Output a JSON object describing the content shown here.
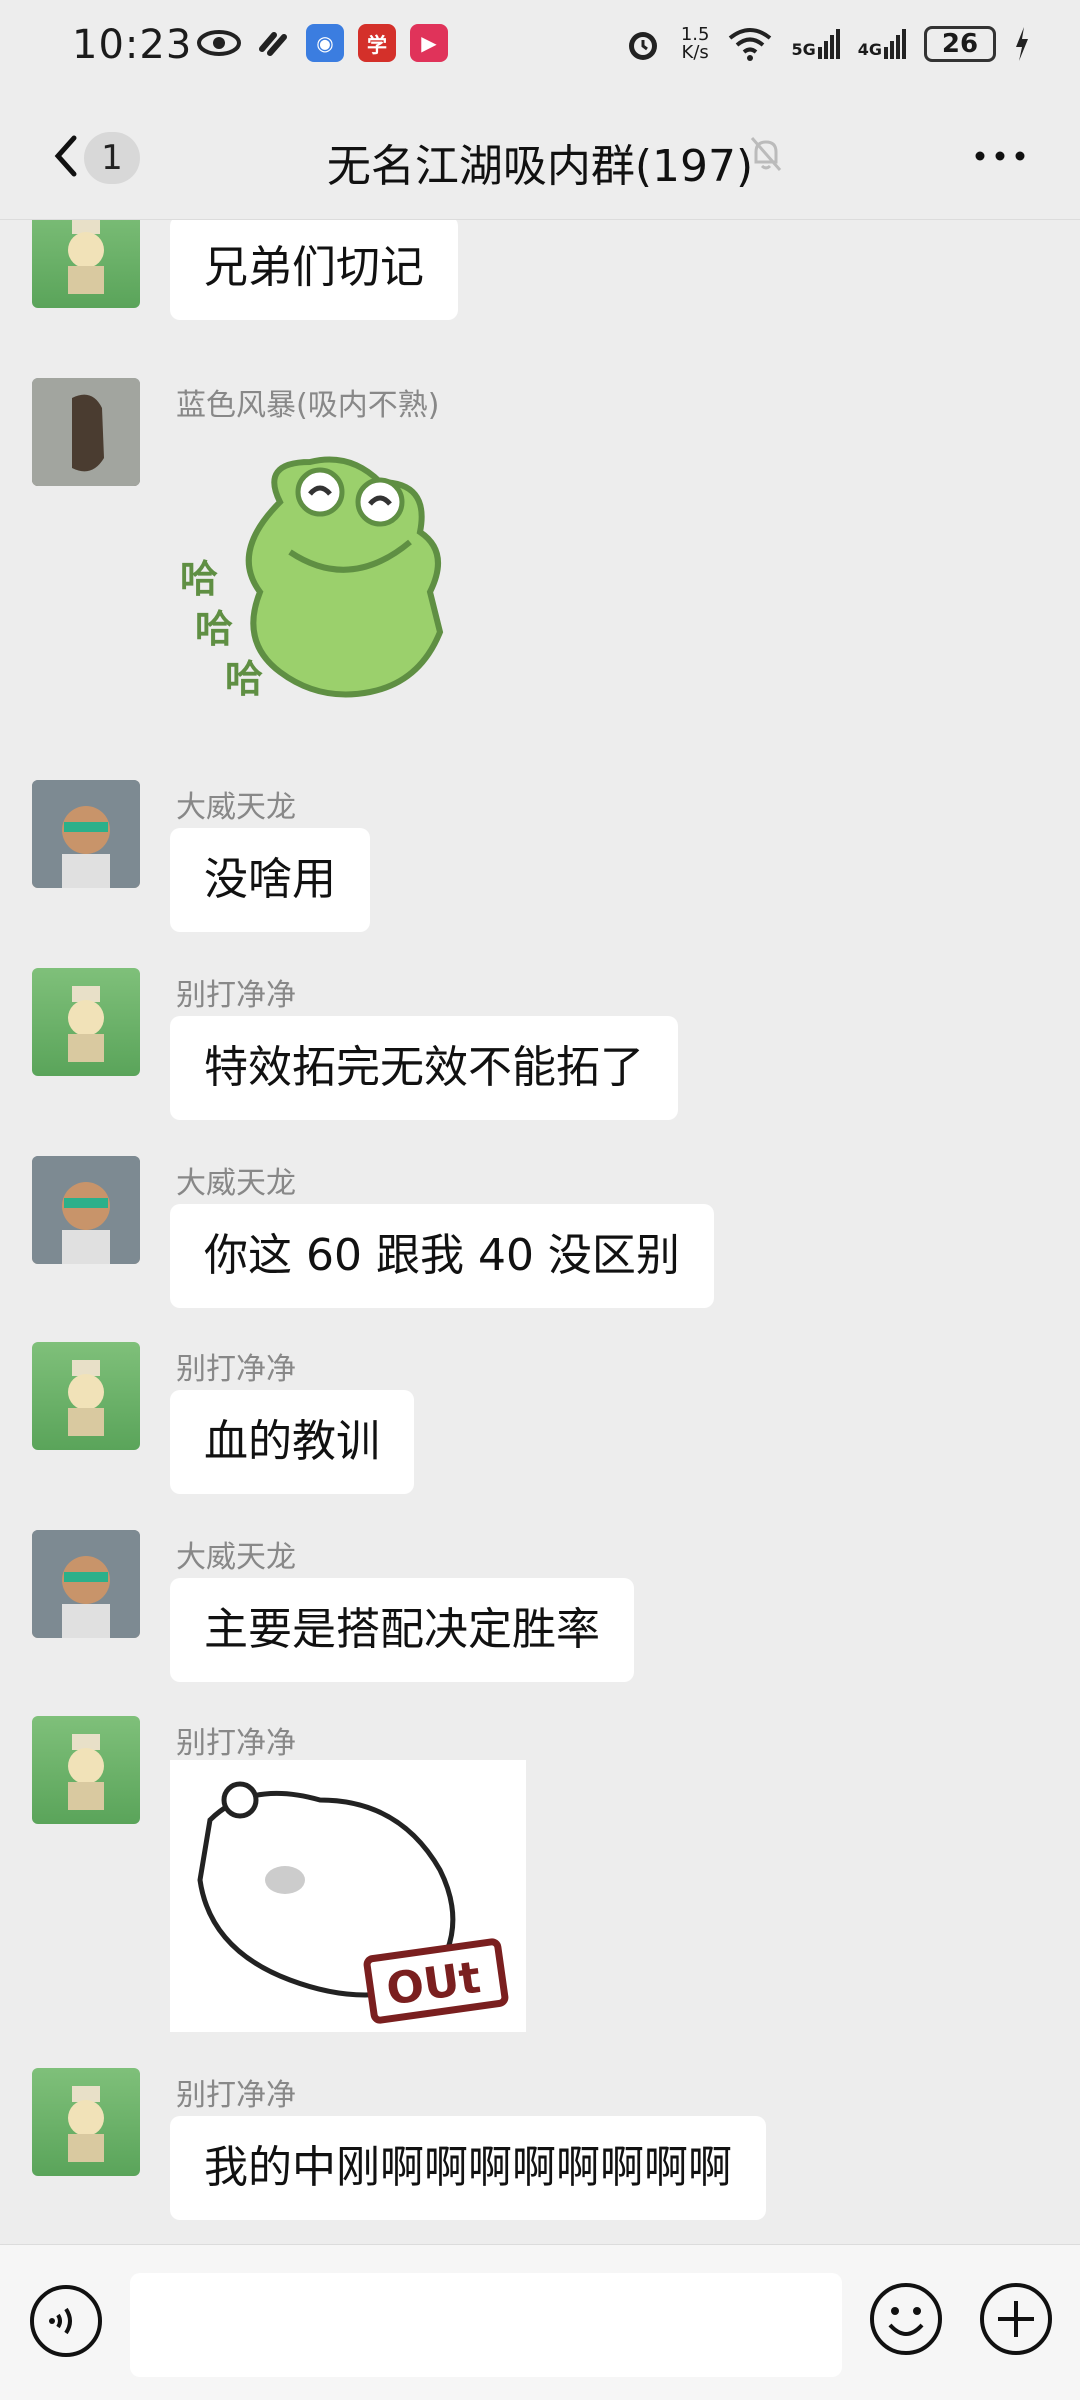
{
  "status": {
    "time": "10:23",
    "net_speed": "1.5\nK/s",
    "signal_5g": "5G",
    "signal_4g": "4G",
    "battery": "26"
  },
  "nav": {
    "unread_count": "1",
    "title": "无名江湖吸内群(197)"
  },
  "messages": [
    {
      "sender": "",
      "text": "兄弟们切记",
      "type": "text"
    },
    {
      "sender": "蓝色风暴(吸内不熟)",
      "type": "sticker",
      "sticker": "laughing-dinosaur",
      "sticker_text": [
        "哈",
        "哈",
        "哈"
      ]
    },
    {
      "sender": "大威天龙",
      "text": "没啥用",
      "type": "text"
    },
    {
      "sender": "别打净净",
      "text": "特效拓完无效不能拓了",
      "type": "text"
    },
    {
      "sender": "大威天龙",
      "text": "你这 60 跟我 40 没区别",
      "type": "text"
    },
    {
      "sender": "别打净净",
      "text": "血的教训",
      "type": "text"
    },
    {
      "sender": "大威天龙",
      "text": "主要是搭配决定胜率",
      "type": "text"
    },
    {
      "sender": "别打净净",
      "type": "sticker",
      "sticker": "bear-out",
      "sticker_text": [
        "OUt"
      ]
    },
    {
      "sender": "别打净净",
      "text": "我的中刚啊啊啊啊啊啊啊啊",
      "type": "text"
    }
  ],
  "input": {
    "placeholder": ""
  },
  "colors": {
    "background": "#ededed",
    "bubble": "#ffffff",
    "sender": "#888888"
  }
}
